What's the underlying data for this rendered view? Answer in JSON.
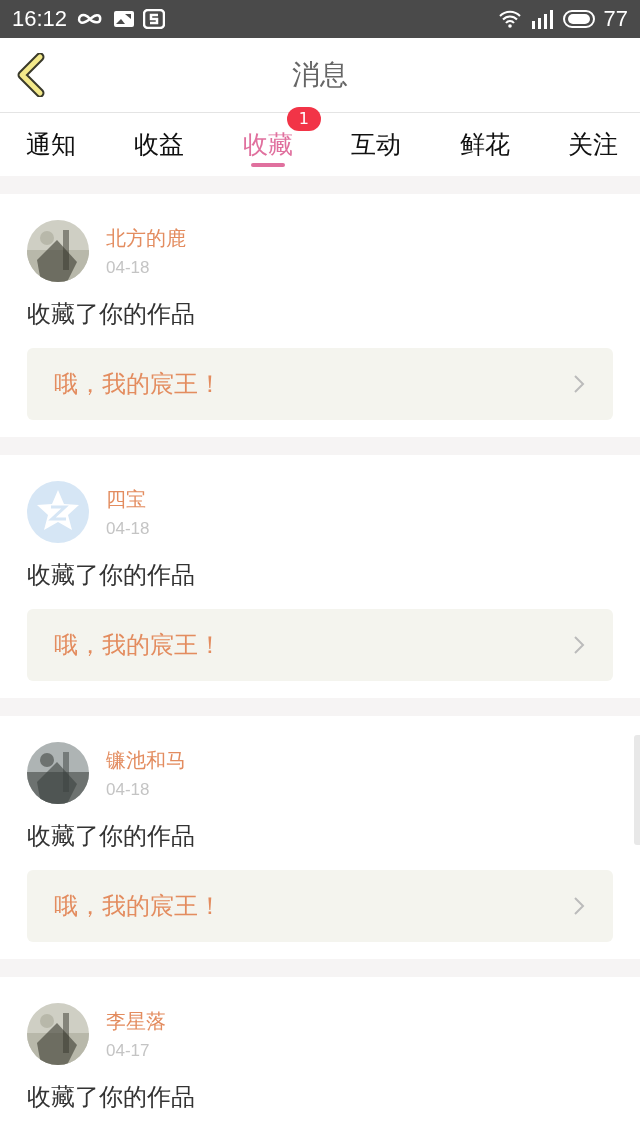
{
  "status_bar": {
    "time": "16:12",
    "battery": "77"
  },
  "header": {
    "title": "消息"
  },
  "tabs": [
    {
      "label": "通知",
      "selected": false
    },
    {
      "label": "收益",
      "selected": false
    },
    {
      "label": "收藏",
      "selected": true,
      "badge": "1"
    },
    {
      "label": "互动",
      "selected": false
    },
    {
      "label": "鲜花",
      "selected": false
    },
    {
      "label": "关注",
      "selected": false
    }
  ],
  "messages": [
    {
      "user": "北方的鹿",
      "date": "04-18",
      "action": "收藏了你的作品",
      "work": "哦，我的宸王！"
    },
    {
      "user": "四宝",
      "avatar": {
        "kind": "default"
      },
      "date": "04-18",
      "action": "收藏了你的作品",
      "work": "哦，我的宸王！"
    },
    {
      "user": "镰池和马",
      "date": "04-18",
      "action": "收藏了你的作品",
      "work": "哦，我的宸王！"
    },
    {
      "user": "李星落",
      "date": "04-17",
      "action": "收藏了你的作品"
    }
  ]
}
